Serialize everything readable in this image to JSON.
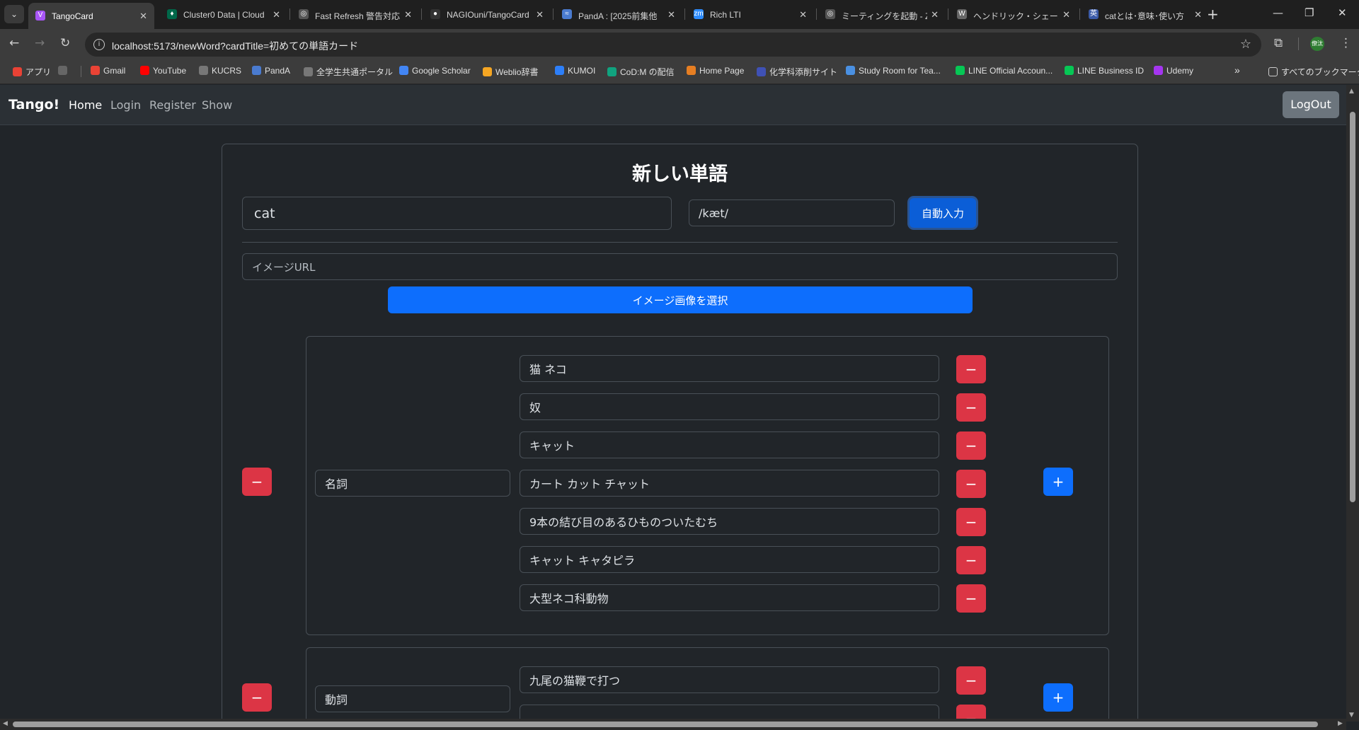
{
  "browser": {
    "tabs": [
      {
        "title": "TangoCard",
        "fav": "V",
        "favcolor": "#a855f7",
        "active": true
      },
      {
        "title": "Cluster0 Data | Cloud",
        "fav": "♦",
        "favcolor": "#00684a"
      },
      {
        "title": "Fast Refresh 警告対応",
        "fav": "◎",
        "favcolor": "#555"
      },
      {
        "title": "NAGIOuni/TangoCard",
        "fav": "●",
        "favcolor": "#333"
      },
      {
        "title": "PandA : [2025前集他",
        "fav": "≈",
        "favcolor": "#4a7bd0"
      },
      {
        "title": "Rich LTI",
        "fav": "zm",
        "favcolor": "#2d8cff"
      },
      {
        "title": "ミーティングを起動 - Zoo",
        "fav": "◎",
        "favcolor": "#555"
      },
      {
        "title": "ヘンドリック・シェーン - W",
        "fav": "W",
        "favcolor": "#666"
      },
      {
        "title": "catとは･意味･使い方",
        "fav": "英",
        "favcolor": "#3b5ba8"
      }
    ],
    "url": "localhost:5173/newWord?cardTitle=初めての単語カード",
    "bookmarks": [
      {
        "label": "アプリ",
        "color": "#e94235"
      },
      {
        "label": "",
        "color": "#666"
      },
      {
        "label": "Gmail",
        "color": "#ea4335"
      },
      {
        "label": "YouTube",
        "color": "#ff0000"
      },
      {
        "label": "KUCRS",
        "color": "#777"
      },
      {
        "label": "PandA",
        "color": "#4a7bd0"
      },
      {
        "label": "全学生共通ポータル",
        "color": "#777"
      },
      {
        "label": "Google Scholar",
        "color": "#4285f4"
      },
      {
        "label": "Weblio辞書",
        "color": "#f5a623"
      },
      {
        "label": "KUMOI",
        "color": "#2d7ff9"
      },
      {
        "label": "CoD:M の配信",
        "color": "#10a37f"
      },
      {
        "label": "Home Page",
        "color": "#e67e22"
      },
      {
        "label": "化学科添削サイト",
        "color": "#3f51b5"
      },
      {
        "label": "Study Room for Tea...",
        "color": "#4a90e2"
      },
      {
        "label": "LINE Official Accoun...",
        "color": "#06c755"
      },
      {
        "label": "LINE Business ID",
        "color": "#06c755"
      },
      {
        "label": "Udemy",
        "color": "#a435f0"
      }
    ],
    "all_bookmarks": "すべてのブックマーク",
    "profile_label": "僚汰"
  },
  "app": {
    "brand": "Tango!",
    "nav": [
      "Home",
      "Login",
      "Register",
      "Show"
    ],
    "logout": "LogOut"
  },
  "form": {
    "title": "新しい単語",
    "word": "cat",
    "pronunciation": "/kæt/",
    "auto_fill": "自動入力",
    "image_url_placeholder": "イメージURL",
    "select_image": "イメージ画像を選択",
    "parts": [
      {
        "pos": "名詞",
        "meanings": [
          "猫 ネコ",
          "奴",
          "キャット",
          "カート カット チャット",
          "9本の結び目のあるひものついたむち",
          "キャット キャタピラ",
          "大型ネコ科動物"
        ]
      },
      {
        "pos": "動詞",
        "meanings": [
          "九尾の猫鞭で打つ",
          ""
        ]
      }
    ]
  }
}
